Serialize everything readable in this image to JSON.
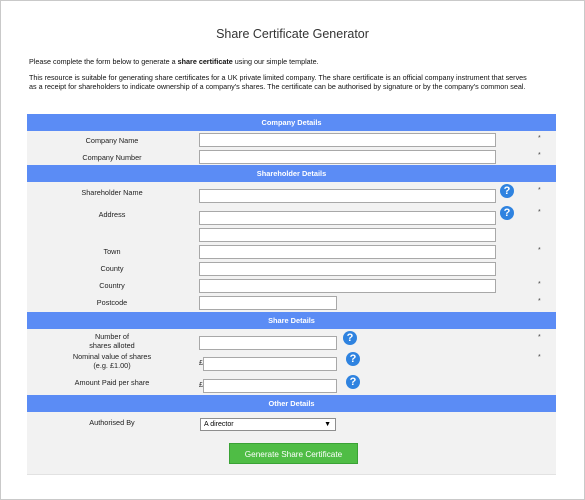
{
  "page": {
    "title": "Share Certificate Generator",
    "intro_prefix": "Please complete the form below to generate a ",
    "intro_bold": "share certificate",
    "intro_suffix": " using our simple template.",
    "description_line1": "This resource is suitable for generating share certificates for a UK private limited company. The share certificate is an official company instrument that serves",
    "description_line2": "as a receipt for shareholders to indicate ownership of a company's shares. The certificate can be authorised by signature or by the company's common seal."
  },
  "sections": {
    "company": "Company Details",
    "shareholder": "Shareholder Details",
    "share": "Share Details",
    "other": "Other Details"
  },
  "fields": {
    "company_name": "Company Name",
    "company_number": "Company Number",
    "shareholder_name": "Shareholder Name",
    "address": "Address",
    "town": "Town",
    "county": "County",
    "country": "Country",
    "postcode": "Postcode",
    "shares_allotted_line1": "Number of",
    "shares_allotted_line2": "shares alloted",
    "nominal_value_line1": "Nominal value of shares",
    "nominal_value_line2": "(e.g. £1.00)",
    "amount_paid": "Amount Paid per share",
    "authorised_by": "Authorised By"
  },
  "symbols": {
    "required": "*",
    "currency": "£",
    "help": "?",
    "dropdown_arrow": "▼"
  },
  "select": {
    "authorised_by_value": "A director"
  },
  "actions": {
    "generate": "Generate Share Certificate"
  },
  "icons": {
    "help": "help-circle-icon",
    "dropdown": "chevron-down-icon"
  },
  "colors": {
    "section_bar": "#5b8cf5",
    "button": "#4fbd45",
    "help_icon": "#2f83e0"
  }
}
